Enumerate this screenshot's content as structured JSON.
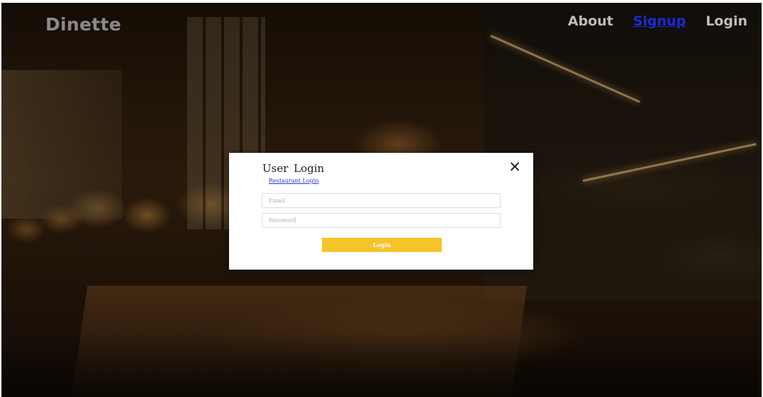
{
  "header": {
    "brand": "Dinette",
    "nav": [
      {
        "label": "About",
        "active": false
      },
      {
        "label": "Signup",
        "active": true
      },
      {
        "label": "Login",
        "active": false
      }
    ]
  },
  "modal": {
    "title": "User  Login",
    "close_icon": "close-icon",
    "restaurant_link": "Restaurant  Login",
    "email": {
      "placeholder": "Email",
      "value": ""
    },
    "password": {
      "placeholder": "Password",
      "value": ""
    },
    "login_label": "Login"
  },
  "colors": {
    "brand_text": "#8a8a8a",
    "nav_text": "#bdbdbd",
    "nav_active": "#1a2bd6",
    "login_button": "#f5c429",
    "link": "#2a35d8"
  }
}
